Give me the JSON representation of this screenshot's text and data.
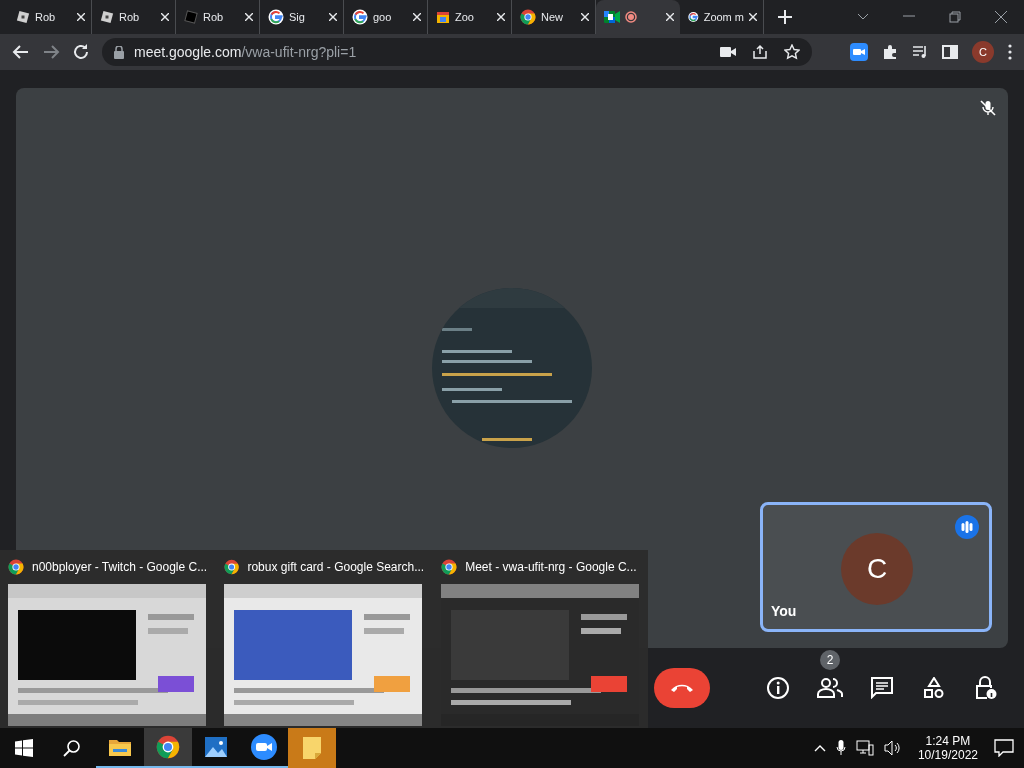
{
  "tabs": [
    {
      "label": "Rob",
      "kind": "cube",
      "selected": false
    },
    {
      "label": "Rob",
      "kind": "cube",
      "selected": false
    },
    {
      "label": "Rob",
      "kind": "dark-cube",
      "selected": false
    },
    {
      "label": "Sig",
      "kind": "google",
      "selected": false
    },
    {
      "label": "goo",
      "kind": "google",
      "selected": false
    },
    {
      "label": "Zoo",
      "kind": "calendar",
      "selected": false
    },
    {
      "label": "New",
      "kind": "chrome",
      "selected": false
    },
    {
      "kind": "meet",
      "recording": true,
      "selected": true
    },
    {
      "label": "Zoom m",
      "kind": "google",
      "selected": false
    }
  ],
  "address_bar": {
    "host": "meet.google.com",
    "path": "/vwa-ufit-nrg?pli=1",
    "profile": "C"
  },
  "meeting": {
    "main_tile": {
      "kind": "picture",
      "muted": true
    },
    "self_tile": {
      "initial": "C",
      "name": "You",
      "speaking": true
    },
    "participants_count": "2"
  },
  "window_previews": [
    {
      "title": "n00bployer - Twitch - Google C..."
    },
    {
      "title": "robux gift card - Google Search..."
    },
    {
      "title": "Meet - vwa-ufit-nrg - Google C..."
    }
  ],
  "taskbar": {
    "apps": [
      {
        "kind": "explorer",
        "highlighted": false,
        "flashing": false
      },
      {
        "kind": "chrome",
        "highlighted": true,
        "flashing": false
      },
      {
        "kind": "photos",
        "highlighted": false,
        "flashing": false
      },
      {
        "kind": "zoom",
        "highlighted": false,
        "flashing": false
      },
      {
        "kind": "notes",
        "highlighted": false,
        "flashing": true
      }
    ],
    "time": "1:24 PM",
    "date": "10/19/2022"
  }
}
